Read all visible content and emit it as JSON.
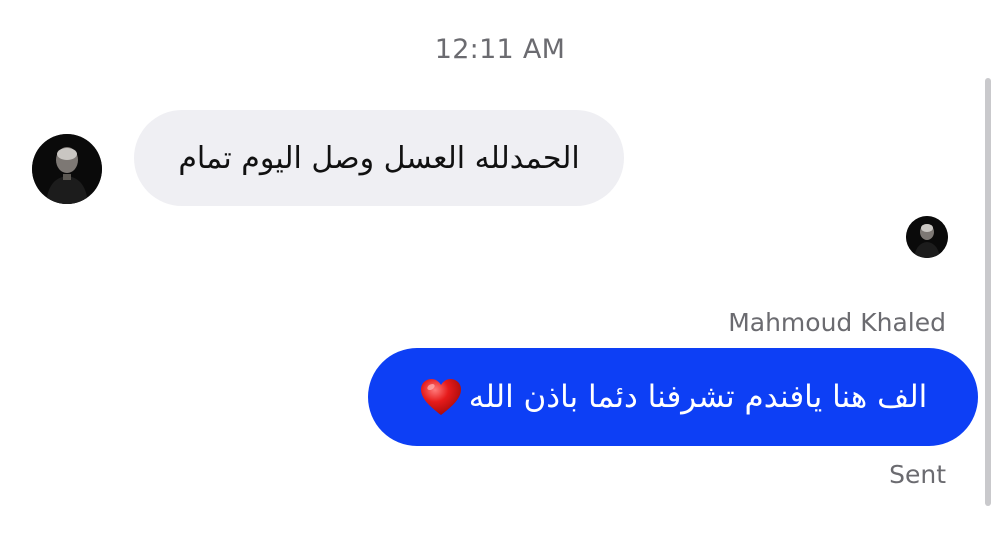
{
  "thread": {
    "timestamp": "12:11 AM"
  },
  "messages": {
    "incoming": {
      "text": "الحمدلله العسل وصل اليوم تمام",
      "avatar_icon": "person-avatar-icon"
    },
    "outgoing": {
      "sender_name": "Mahmoud Khaled",
      "text": "الف هنا يافندم تشرفنا دئما باذن الله",
      "emoji_icon": "red-heart-icon",
      "status": "Sent"
    },
    "read_receipt": {
      "avatar_icon": "person-avatar-icon"
    }
  },
  "colors": {
    "outgoing_bubble": "#0d3ff5",
    "incoming_bubble": "#efeff3",
    "meta_text": "#6b6b70"
  }
}
